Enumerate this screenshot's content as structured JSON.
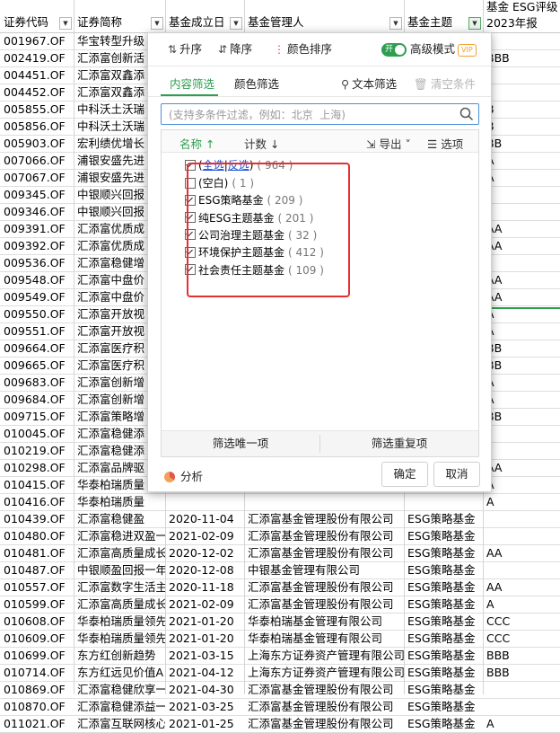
{
  "headers": {
    "code": "证券代码",
    "name": "证券简称",
    "founded": "基金成立日",
    "manager": "基金管理人",
    "theme": "基金主题",
    "esg_line1": "基金 ESG评级",
    "esg_line2": "2023年报"
  },
  "rows": [
    [
      "001967.OF",
      "华宝转型升级",
      "",
      "",
      "",
      ""
    ],
    [
      "002419.OF",
      "汇添富创新活",
      "",
      "",
      "",
      "BBB"
    ],
    [
      "004451.OF",
      "汇添富双鑫添",
      "",
      "",
      "",
      ""
    ],
    [
      "004452.OF",
      "汇添富双鑫添",
      "",
      "",
      "",
      ""
    ],
    [
      "005855.OF",
      "中科沃土沃瑞",
      "",
      "",
      "",
      "B"
    ],
    [
      "005856.OF",
      "中科沃土沃瑞",
      "",
      "",
      "",
      "B"
    ],
    [
      "005903.OF",
      "宏利绩优增长",
      "",
      "",
      "",
      "BB"
    ],
    [
      "007066.OF",
      "浦银安盛先进",
      "",
      "",
      "",
      "A"
    ],
    [
      "007067.OF",
      "浦银安盛先进",
      "",
      "",
      "",
      "A"
    ],
    [
      "009345.OF",
      "中银顺兴回报",
      "",
      "",
      "",
      ""
    ],
    [
      "009346.OF",
      "中银顺兴回报",
      "",
      "",
      "",
      ""
    ],
    [
      "009391.OF",
      "汇添富优质成",
      "",
      "",
      "",
      "AA"
    ],
    [
      "009392.OF",
      "汇添富优质成",
      "",
      "",
      "",
      "AA"
    ],
    [
      "009536.OF",
      "汇添富稳健增",
      "",
      "",
      "",
      ""
    ],
    [
      "009548.OF",
      "汇添富中盘价",
      "",
      "",
      "",
      "AA"
    ],
    [
      "009549.OF",
      "汇添富中盘价",
      "",
      "",
      "",
      "AA"
    ],
    [
      "009550.OF",
      "汇添富开放视",
      "",
      "",
      "",
      "A"
    ],
    [
      "009551.OF",
      "汇添富开放视",
      "",
      "",
      "",
      "A"
    ],
    [
      "009664.OF",
      "汇添富医疗积",
      "",
      "",
      "",
      "BB"
    ],
    [
      "009665.OF",
      "汇添富医疗积",
      "",
      "",
      "",
      "BB"
    ],
    [
      "009683.OF",
      "汇添富创新增",
      "",
      "",
      "",
      "A"
    ],
    [
      "009684.OF",
      "汇添富创新增",
      "",
      "",
      "",
      "A"
    ],
    [
      "009715.OF",
      "汇添富策略增",
      "",
      "",
      "",
      "BB"
    ],
    [
      "010045.OF",
      "汇添富稳健添",
      "",
      "",
      "",
      ""
    ],
    [
      "010219.OF",
      "汇添富稳健添",
      "",
      "",
      "",
      ""
    ],
    [
      "010298.OF",
      "汇添富品牌驱",
      "",
      "",
      "",
      "AA"
    ],
    [
      "010415.OF",
      "华泰柏瑞质量",
      "",
      "",
      "",
      "A"
    ],
    [
      "010416.OF",
      "华泰柏瑞质量",
      "",
      "",
      "",
      "A"
    ],
    [
      "010439.OF",
      "汇添富稳健盈",
      "",
      "",
      "",
      ""
    ],
    [
      "010480.OF",
      "汇添富稳进双盈一",
      "2021-02-09",
      "汇添富基金管理股份有限公司",
      "ESG策略基金",
      ""
    ],
    [
      "010481.OF",
      "汇添富高质量成长",
      "2020-12-02",
      "汇添富基金管理股份有限公司",
      "ESG策略基金",
      "AA"
    ],
    [
      "010487.OF",
      "中银顺盈回报一年",
      "2020-12-08",
      "中银基金管理有限公司",
      "ESG策略基金",
      ""
    ],
    [
      "010557.OF",
      "汇添富数字生活主",
      "2020-11-18",
      "汇添富基金管理股份有限公司",
      "ESG策略基金",
      "AA"
    ],
    [
      "010599.OF",
      "汇添富高质量成长",
      "2021-02-09",
      "汇添富基金管理股份有限公司",
      "ESG策略基金",
      "A"
    ],
    [
      "010608.OF",
      "华泰柏瑞质量领先",
      "2021-01-20",
      "华泰柏瑞基金管理有限公司",
      "ESG策略基金",
      "CCC"
    ],
    [
      "010609.OF",
      "华泰柏瑞质量领先",
      "2021-01-20",
      "华泰柏瑞基金管理有限公司",
      "ESG策略基金",
      "CCC"
    ],
    [
      "010699.OF",
      "东方红创新趋势",
      "2021-03-15",
      "上海东方证券资产管理有限公司",
      "ESG策略基金",
      "BBB"
    ],
    [
      "010714.OF",
      "东方红远见价值A",
      "2021-04-12",
      "上海东方证券资产管理有限公司",
      "ESG策略基金",
      "BBB"
    ],
    [
      "010869.OF",
      "汇添富稳健欣享一",
      "2021-04-30",
      "汇添富基金管理股份有限公司",
      "ESG策略基金",
      ""
    ],
    [
      "010870.OF",
      "汇添富稳健添益一",
      "2021-03-25",
      "汇添富基金管理股份有限公司",
      "ESG策略基金",
      ""
    ],
    [
      "011021.OF",
      "汇添富互联网核心",
      "2021-01-25",
      "汇添富基金管理股份有限公司",
      "ESG策略基金",
      "A"
    ]
  ],
  "partial_row_010439": {
    "founded": "2020-11-04",
    "manager": "汇添富基金管理股份有限公司",
    "theme": "ESG策略基金"
  },
  "popup": {
    "sort_asc": "升序",
    "sort_desc": "降序",
    "color_sort": "颜色排序",
    "toggle_on": "开",
    "advanced_mode": "高级模式",
    "vip": "VIP",
    "tab_content": "内容筛选",
    "tab_color": "颜色筛选",
    "text_filter": "文本筛选",
    "clear_condition": "清空条件",
    "search_placeholder": "(支持多条件过滤，例如：北京  上海)",
    "col_name": "名称",
    "col_count": "计数",
    "export": "导出",
    "options": "选项",
    "select_all": "全选",
    "invert": "反选",
    "total_count": "( 964 )",
    "items": [
      {
        "label": "(空白)",
        "count": "( 1 )",
        "checked": false
      },
      {
        "label": "ESG策略基金",
        "count": "( 209 )",
        "checked": true
      },
      {
        "label": "纯ESG主题基金",
        "count": "( 201 )",
        "checked": true
      },
      {
        "label": "公司治理主题基金",
        "count": "( 32 )",
        "checked": true
      },
      {
        "label": "环境保护主题基金",
        "count": "( 412 )",
        "checked": true
      },
      {
        "label": "社会责任主题基金",
        "count": "( 109 )",
        "checked": true
      }
    ],
    "filter_unique": "筛选唯一项",
    "filter_duplicate": "筛选重复项",
    "analysis": "分析",
    "ok": "确定",
    "cancel": "取消"
  }
}
